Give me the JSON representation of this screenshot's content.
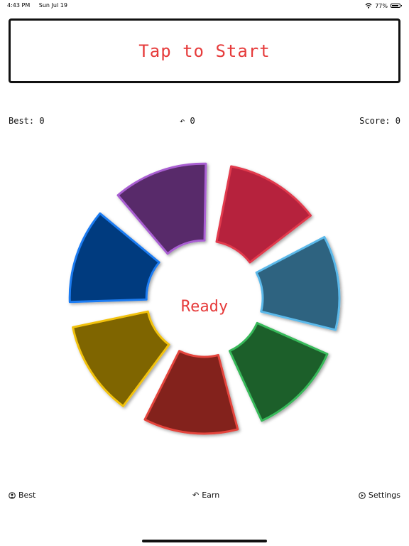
{
  "status": {
    "time": "4:43 PM",
    "date": "Sun Jul 19",
    "battery": "77%"
  },
  "header": {
    "start_label": "Tap to Start"
  },
  "stats": {
    "best_label": "Best:",
    "best_value": "0",
    "undo_value": "0",
    "score_label": "Score:",
    "score_value": "0"
  },
  "wheel": {
    "center_text": "Ready",
    "segments": [
      {
        "name": "red",
        "fill": "#b6203c",
        "stroke": "#e23b4e"
      },
      {
        "name": "blue",
        "fill": "#2d6480",
        "stroke": "#5bb9ea"
      },
      {
        "name": "green",
        "fill": "#1c5f2c",
        "stroke": "#38b95a"
      },
      {
        "name": "dark-red",
        "fill": "#83201b",
        "stroke": "#e4443d"
      },
      {
        "name": "olive",
        "fill": "#7f6500",
        "stroke": "#f2c20f"
      },
      {
        "name": "navy",
        "fill": "#033b7f",
        "stroke": "#1d7cf2"
      },
      {
        "name": "purple",
        "fill": "#58296b",
        "stroke": "#a95fd2"
      }
    ]
  },
  "bottom": {
    "best_label": "Best",
    "earn_label": "Earn",
    "settings_label": "Settings"
  }
}
